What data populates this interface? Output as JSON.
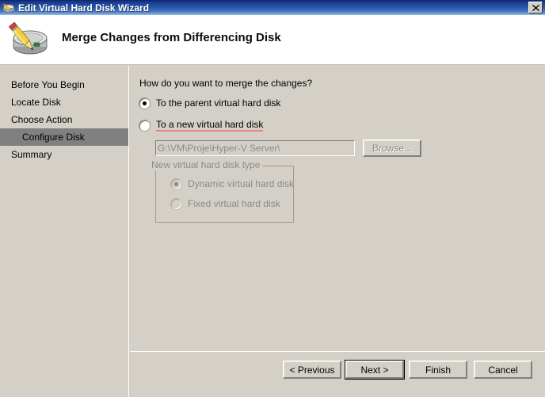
{
  "window": {
    "title": "Edit Virtual Hard Disk Wizard",
    "title_icon": "disk-pencil-icon",
    "close_label": "✕",
    "titlebar_color": "#0a246a",
    "body_color": "#d4d0c8"
  },
  "header": {
    "title": "Merge Changes from Differencing Disk",
    "icon": "hard-disk-pencil-icon"
  },
  "sidebar": {
    "items": [
      {
        "label": "Before You Begin",
        "selected": false,
        "indent": false
      },
      {
        "label": "Locate Disk",
        "selected": false,
        "indent": false
      },
      {
        "label": "Choose Action",
        "selected": false,
        "indent": false
      },
      {
        "label": "Configure Disk",
        "selected": true,
        "indent": true
      },
      {
        "label": "Summary",
        "selected": false,
        "indent": false
      }
    ],
    "selected_color": "#808080"
  },
  "main": {
    "question": "How do you want to merge the changes?",
    "options": [
      {
        "label": "To the parent virtual hard disk",
        "checked": true,
        "disabled": false
      },
      {
        "label": "To a new virtual hard disk",
        "checked": false,
        "disabled": false
      }
    ],
    "path_field": {
      "value": "G:\\VM\\Proje\\Hyper-V Server\\",
      "placeholder": "G:\\VM\\Proje\\Hyper-V Server\\",
      "disabled": true
    },
    "browse_label": "Browse...",
    "groupbox": {
      "title": "New virtual hard disk type",
      "options": [
        {
          "label": "Dynamic virtual hard disk",
          "checked": true,
          "disabled": true
        },
        {
          "label": "Fixed virtual hard disk",
          "checked": false,
          "disabled": true
        }
      ]
    }
  },
  "footer": {
    "buttons": [
      {
        "label": "< Previous",
        "focused": false
      },
      {
        "label": "Next >",
        "focused": true
      },
      {
        "label": "Finish",
        "focused": false
      },
      {
        "label": "Cancel",
        "focused": false
      }
    ]
  }
}
